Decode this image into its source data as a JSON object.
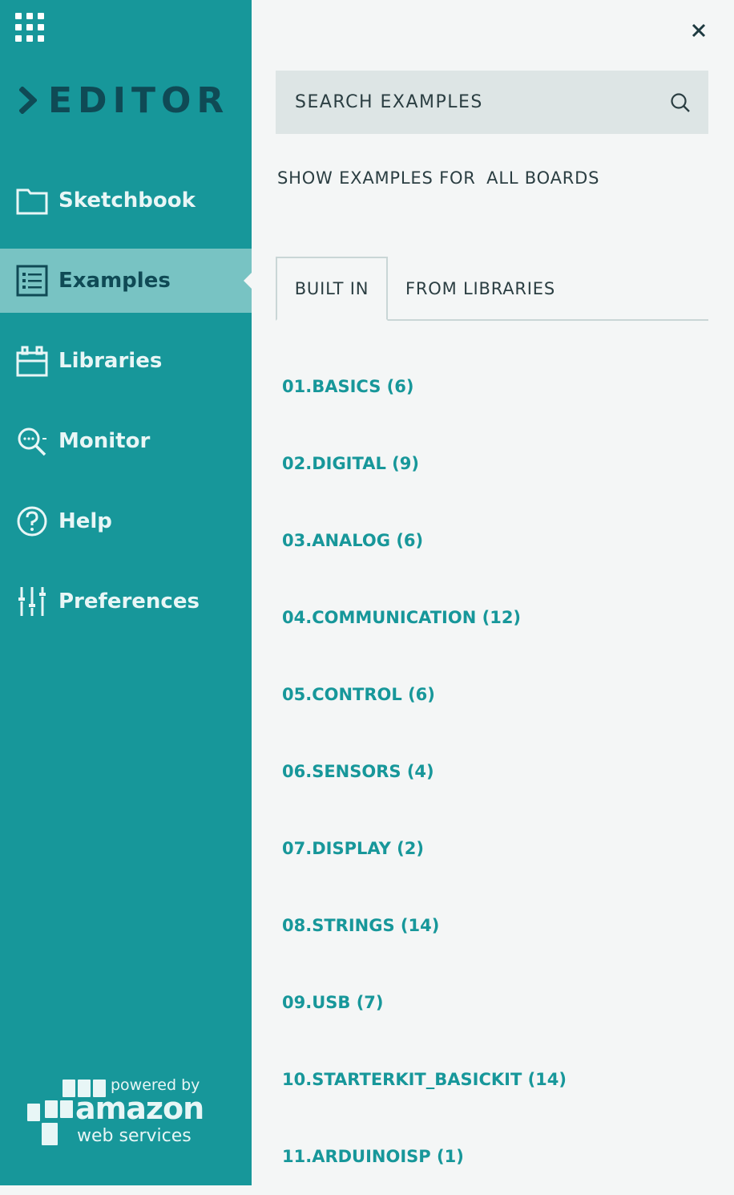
{
  "app": {
    "title": "EDITOR"
  },
  "colors": {
    "sidebar": "#17979a",
    "active": "#78c3c3",
    "dark": "#0f4a55",
    "link": "#17979a"
  },
  "sidebar": {
    "items": [
      {
        "label": "Sketchbook",
        "icon": "folder-icon"
      },
      {
        "label": "Examples",
        "icon": "list-icon",
        "active": true
      },
      {
        "label": "Libraries",
        "icon": "libraries-icon"
      },
      {
        "label": "Monitor",
        "icon": "monitor-icon"
      },
      {
        "label": "Help",
        "icon": "help-icon"
      },
      {
        "label": "Preferences",
        "icon": "sliders-icon"
      }
    ],
    "aws": {
      "powered": "powered by",
      "amazon": "amazon",
      "web_services": "web services"
    }
  },
  "panel": {
    "search_placeholder": "SEARCH EXAMPLES",
    "show_for_prefix": "SHOW EXAMPLES FOR",
    "show_for_boards": "ALL BOARDS",
    "tabs": [
      {
        "label": "BUILT IN",
        "active": true
      },
      {
        "label": "FROM LIBRARIES",
        "active": false
      }
    ],
    "examples": [
      "01.BASICS (6)",
      "02.DIGITAL (9)",
      "03.ANALOG (6)",
      "04.COMMUNICATION (12)",
      "05.CONTROL (6)",
      "06.SENSORS (4)",
      "07.DISPLAY (2)",
      "08.STRINGS (14)",
      "09.USB (7)",
      "10.STARTERKIT_BASICKIT (14)",
      "11.ARDUINOISP (1)"
    ]
  }
}
